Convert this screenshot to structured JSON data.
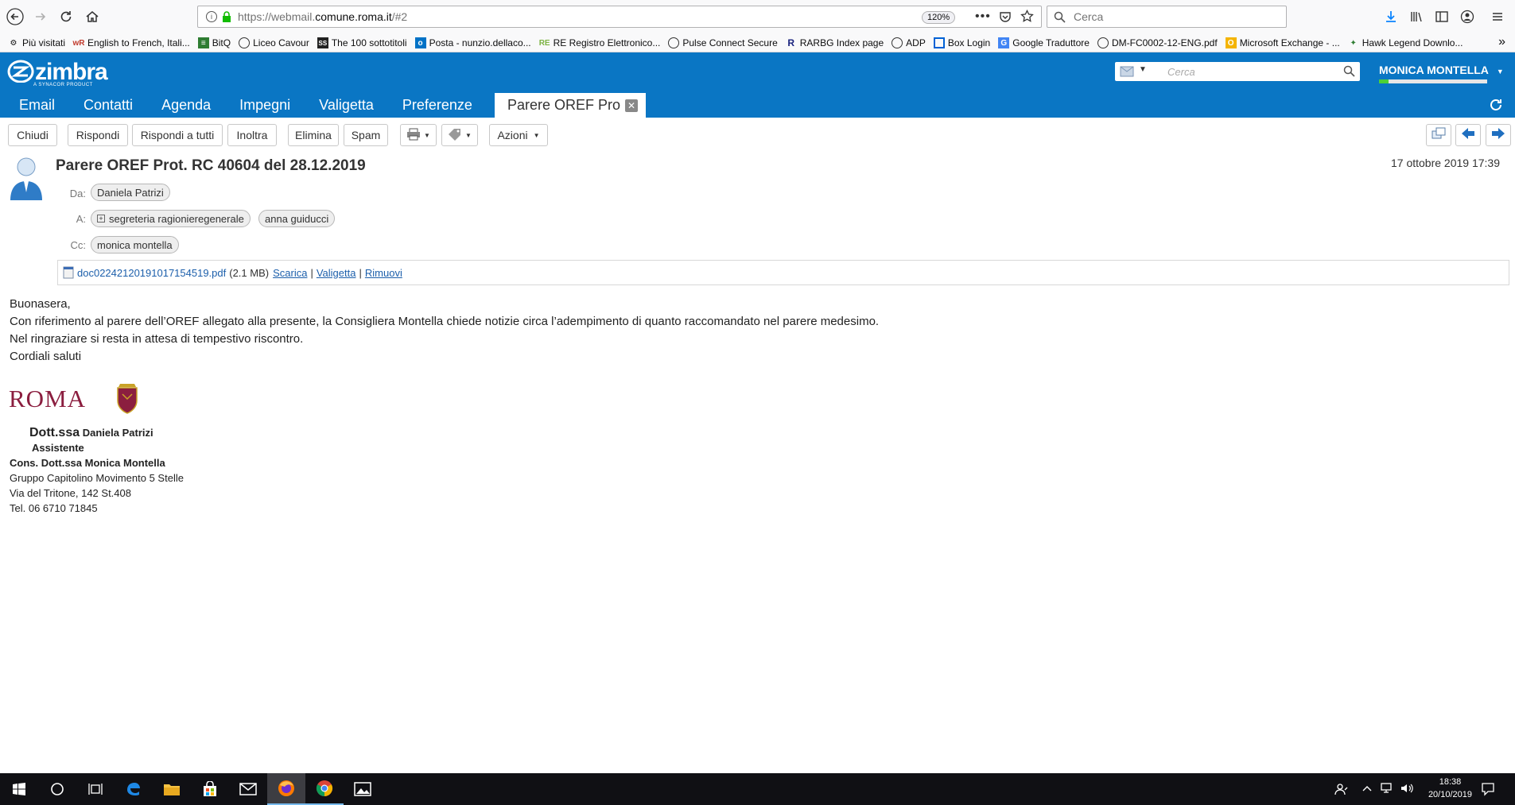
{
  "browser": {
    "url_prefix": "https://webmail.",
    "url_host": "comune.roma.it",
    "url_suffix": "/#2",
    "zoom": "120%",
    "search_placeholder": "Cerca",
    "bookmarks": [
      {
        "label": "Più visitati",
        "icon": "gear-icon"
      },
      {
        "label": "English to French, Itali...",
        "icon": "wordreference-icon"
      },
      {
        "label": "BitQ",
        "icon": "bitq-icon"
      },
      {
        "label": "Liceo Cavour",
        "icon": "school-icon"
      },
      {
        "label": "The 100 sottotitoli",
        "icon": "subtitles-icon"
      },
      {
        "label": "Posta - nunzio.dellaco...",
        "icon": "outlook-icon"
      },
      {
        "label": "RE Registro Elettronico...",
        "icon": "registro-icon"
      },
      {
        "label": "Pulse Connect Secure",
        "icon": "globe-icon"
      },
      {
        "label": "RARBG Index page",
        "icon": "rarbg-icon"
      },
      {
        "label": "ADP",
        "icon": "globe-icon"
      },
      {
        "label": "Box Login",
        "icon": "box-icon"
      },
      {
        "label": "Google Traduttore",
        "icon": "translate-icon"
      },
      {
        "label": "DM-FC0002-12-ENG.pdf",
        "icon": "globe-icon"
      },
      {
        "label": "Microsoft Exchange - ...",
        "icon": "exchange-icon"
      },
      {
        "label": "Hawk Legend Downlo...",
        "icon": "hawk-icon"
      }
    ]
  },
  "zimbra": {
    "logo": "zimbra",
    "logo_sub": "A SYNACOR PRODUCT",
    "search_placeholder": "Cerca",
    "user_name": "MONICA MONTELLA",
    "quota_fraction": 0.09,
    "tabs": [
      "Email",
      "Contatti",
      "Agenda",
      "Impegni",
      "Valigetta",
      "Preferenze"
    ],
    "active_tab": "Parere OREF Pro",
    "accent_color": "#0a76c4"
  },
  "toolbar": {
    "close": "Chiudi",
    "reply": "Rispondi",
    "reply_all": "Rispondi a tutti",
    "forward": "Inoltra",
    "delete": "Elimina",
    "spam": "Spam",
    "actions": "Azioni"
  },
  "message": {
    "subject": "Parere OREF Prot. RC 40604 del 28.12.2019",
    "date": "17 ottobre 2019 17:39",
    "from_label": "Da:",
    "from": "Daniela Patrizi",
    "to_label": "A:",
    "to": [
      "segreteria ragionieregenerale",
      "anna guiducci"
    ],
    "cc_label": "Cc:",
    "cc": [
      "monica montella"
    ],
    "attachment": {
      "name": "doc02242120191017154519.pdf",
      "size": "(2.1 MB)",
      "download": "Scarica",
      "briefcase": "Valigetta",
      "remove": "Rimuovi",
      "sep": "|"
    },
    "body": [
      "Buonasera,",
      "Con riferimento al parere dell’OREF allegato alla presente, la  Consigliera Montella chiede notizie circa l’adempimento di quanto raccomandato nel parere medesimo.",
      "Nel ringraziare si resta in attesa di tempestivo riscontro.",
      "Cordiali saluti"
    ],
    "signature": {
      "logo_text": "ROMA",
      "title_prefix": "Dott.ssa",
      "name": "Daniela Patrizi",
      "role": "Assistente",
      "cons": "Cons. Dott.ssa Monica Montella",
      "group": "Gruppo Capitolino Movimento 5 Stelle",
      "address": "Via del Tritone, 142 St.408",
      "phone": "Tel. 06 6710 71845"
    }
  },
  "taskbar": {
    "time": "18:38",
    "date": "20/10/2019"
  }
}
